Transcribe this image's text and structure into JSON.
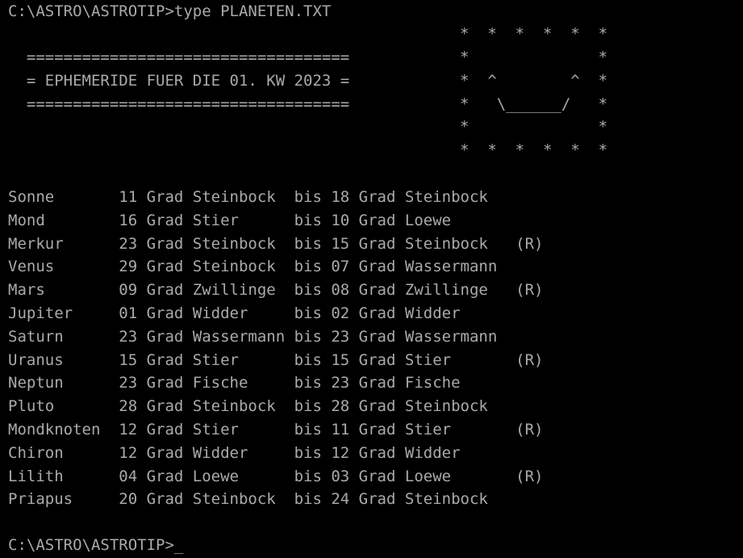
{
  "terminal": {
    "background_color": "#000000",
    "text_color": "#aaaaaa",
    "prompt_top": "C:\\ASTRO\\ASTROTIP>type PLANETEN.TXT",
    "prompt_bottom": "C:\\ASTRO\\ASTROTIP>",
    "cursor": "_"
  },
  "header": {
    "rule_top": "  ===================================",
    "title_line": "  = EPHEMERIDE FUER DIE 01. KW 2023 =",
    "rule_bottom": "  ===================================",
    "title_text": "EPHEMERIDE FUER DIE 01. KW 2023"
  },
  "ascii_art": {
    "name": "smiley-face",
    "lines": [
      "*  *  *  *  *  *",
      "*              *",
      "*  ^        ^  *",
      "*   \\______/   *",
      "*              *",
      "*  *  *  *  *  *"
    ]
  },
  "table": {
    "columns": [
      "body",
      "start_degree",
      "start_unit",
      "start_sign",
      "separator",
      "end_degree",
      "end_unit",
      "end_sign",
      "retrograde"
    ],
    "unit_label": "Grad",
    "separator_label": "bis",
    "retrograde_label": "(R)",
    "rows": [
      {
        "line": "Sonne       11 Grad Steinbock  bis 18 Grad Steinbock"
      },
      {
        "line": "Mond        16 Grad Stier      bis 10 Grad Loewe"
      },
      {
        "line": "Merkur      23 Grad Steinbock  bis 15 Grad Steinbock   (R)"
      },
      {
        "line": "Venus       29 Grad Steinbock  bis 07 Grad Wassermann"
      },
      {
        "line": "Mars        09 Grad Zwillinge  bis 08 Grad Zwillinge   (R)"
      },
      {
        "line": "Jupiter     01 Grad Widder     bis 02 Grad Widder"
      },
      {
        "line": "Saturn      23 Grad Wassermann bis 23 Grad Wassermann"
      },
      {
        "line": "Uranus      15 Grad Stier      bis 15 Grad Stier       (R)"
      },
      {
        "line": "Neptun      23 Grad Fische     bis 23 Grad Fische"
      },
      {
        "line": "Pluto       28 Grad Steinbock  bis 28 Grad Steinbock"
      },
      {
        "line": "Mondknoten  12 Grad Stier      bis 11 Grad Stier       (R)"
      },
      {
        "line": "Chiron      12 Grad Widder     bis 12 Grad Widder"
      },
      {
        "line": "Lilith      04 Grad Loewe      bis 03 Grad Loewe       (R)"
      },
      {
        "line": "Priapus     20 Grad Steinbock  bis 24 Grad Steinbock"
      }
    ],
    "entries": [
      {
        "body": "Sonne",
        "start_degree": "11",
        "start_sign": "Steinbock",
        "end_degree": "18",
        "end_sign": "Steinbock",
        "retrograde": ""
      },
      {
        "body": "Mond",
        "start_degree": "16",
        "start_sign": "Stier",
        "end_degree": "10",
        "end_sign": "Loewe",
        "retrograde": ""
      },
      {
        "body": "Merkur",
        "start_degree": "23",
        "start_sign": "Steinbock",
        "end_degree": "15",
        "end_sign": "Steinbock",
        "retrograde": "(R)"
      },
      {
        "body": "Venus",
        "start_degree": "29",
        "start_sign": "Steinbock",
        "end_degree": "07",
        "end_sign": "Wassermann",
        "retrograde": ""
      },
      {
        "body": "Mars",
        "start_degree": "09",
        "start_sign": "Zwillinge",
        "end_degree": "08",
        "end_sign": "Zwillinge",
        "retrograde": "(R)"
      },
      {
        "body": "Jupiter",
        "start_degree": "01",
        "start_sign": "Widder",
        "end_degree": "02",
        "end_sign": "Widder",
        "retrograde": ""
      },
      {
        "body": "Saturn",
        "start_degree": "23",
        "start_sign": "Wassermann",
        "end_degree": "23",
        "end_sign": "Wassermann",
        "retrograde": ""
      },
      {
        "body": "Uranus",
        "start_degree": "15",
        "start_sign": "Stier",
        "end_degree": "15",
        "end_sign": "Stier",
        "retrograde": "(R)"
      },
      {
        "body": "Neptun",
        "start_degree": "23",
        "start_sign": "Fische",
        "end_degree": "23",
        "end_sign": "Fische",
        "retrograde": ""
      },
      {
        "body": "Pluto",
        "start_degree": "28",
        "start_sign": "Steinbock",
        "end_degree": "28",
        "end_sign": "Steinbock",
        "retrograde": ""
      },
      {
        "body": "Mondknoten",
        "start_degree": "12",
        "start_sign": "Stier",
        "end_degree": "11",
        "end_sign": "Stier",
        "retrograde": "(R)"
      },
      {
        "body": "Chiron",
        "start_degree": "12",
        "start_sign": "Widder",
        "end_degree": "12",
        "end_sign": "Widder",
        "retrograde": ""
      },
      {
        "body": "Lilith",
        "start_degree": "04",
        "start_sign": "Loewe",
        "end_degree": "03",
        "end_sign": "Loewe",
        "retrograde": "(R)"
      },
      {
        "body": "Priapus",
        "start_degree": "20",
        "start_sign": "Steinbock",
        "end_degree": "24",
        "end_sign": "Steinbock",
        "retrograde": ""
      }
    ]
  }
}
